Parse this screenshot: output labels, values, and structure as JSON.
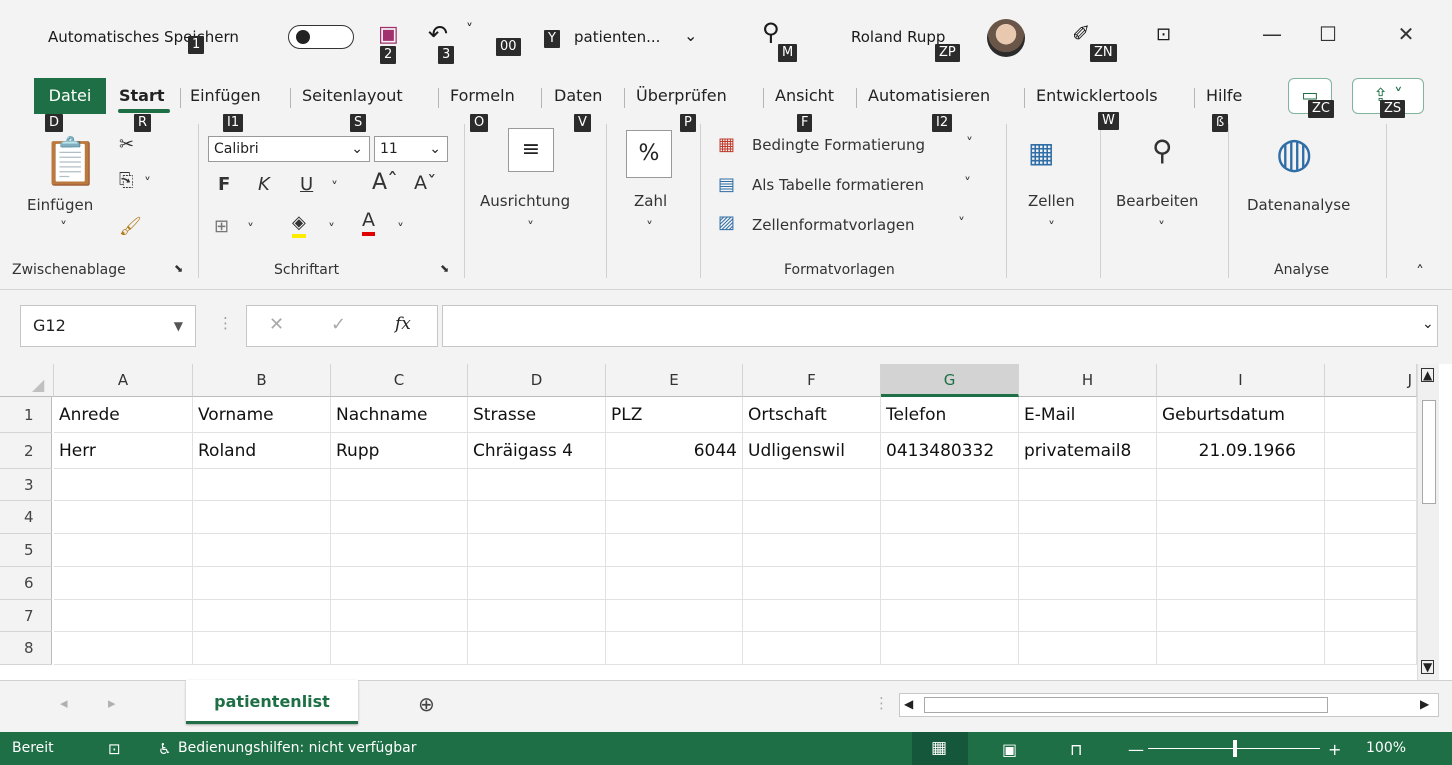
{
  "titlebar": {
    "autosave_label": "Automatisches Speichern",
    "filename": "patienten...",
    "user": "Roland Rupp"
  },
  "tabs": [
    "Datei",
    "Start",
    "Einfügen",
    "Seitenlayout",
    "Formeln",
    "Daten",
    "Überprüfen",
    "Ansicht",
    "Automatisieren",
    "Entwicklertools",
    "Hilfe"
  ],
  "keytips": [
    "1",
    "2",
    "3",
    "00",
    "Y",
    "M",
    "ZP",
    "ZN",
    "D",
    "R",
    "I1",
    "S",
    "O",
    "V",
    "P",
    "F",
    "I2",
    "W",
    "ß",
    "ZC",
    "ZS"
  ],
  "ribbon": {
    "clipboard": {
      "paste": "Einfügen",
      "group": "Zwischenablage"
    },
    "font": {
      "name": "Calibri",
      "size": "11",
      "bold": "F",
      "italic": "K",
      "underline": "U",
      "group": "Schriftart"
    },
    "alignment": "Ausrichtung",
    "number": "Zahl",
    "styles": {
      "conditional": "Bedingte Formatierung",
      "table": "Als Tabelle formatieren",
      "cellstyles": "Zellenformatvorlagen",
      "group": "Formatvorlagen"
    },
    "cells": "Zellen",
    "editing": "Bearbeiten",
    "analysis": {
      "button": "Datenanalyse",
      "group": "Analyse"
    }
  },
  "formula_bar": {
    "name_box": "G12",
    "fx": "fx",
    "value": ""
  },
  "grid": {
    "columns": [
      "A",
      "B",
      "C",
      "D",
      "E",
      "F",
      "G",
      "H",
      "I",
      "J"
    ],
    "rows": [
      "1",
      "2",
      "3",
      "4",
      "5",
      "6",
      "7",
      "8"
    ],
    "header_row": [
      "Anrede",
      "Vorname",
      "Nachname",
      "Strasse",
      "PLZ",
      "Ortschaft",
      "Telefon",
      "E-Mail",
      "Geburtsdatum"
    ],
    "data_row": [
      "Herr",
      "Roland",
      "Rupp",
      "Chräigass 4",
      "6044",
      "Udligenswil",
      "0413480332",
      "privatemail8",
      "21.09.1966"
    ]
  },
  "sheet": {
    "tab": "patientenlist"
  },
  "status": {
    "ready": "Bereit",
    "accessibility": "Bedienungshilfen: nicht verfügbar",
    "zoom": "100%"
  }
}
